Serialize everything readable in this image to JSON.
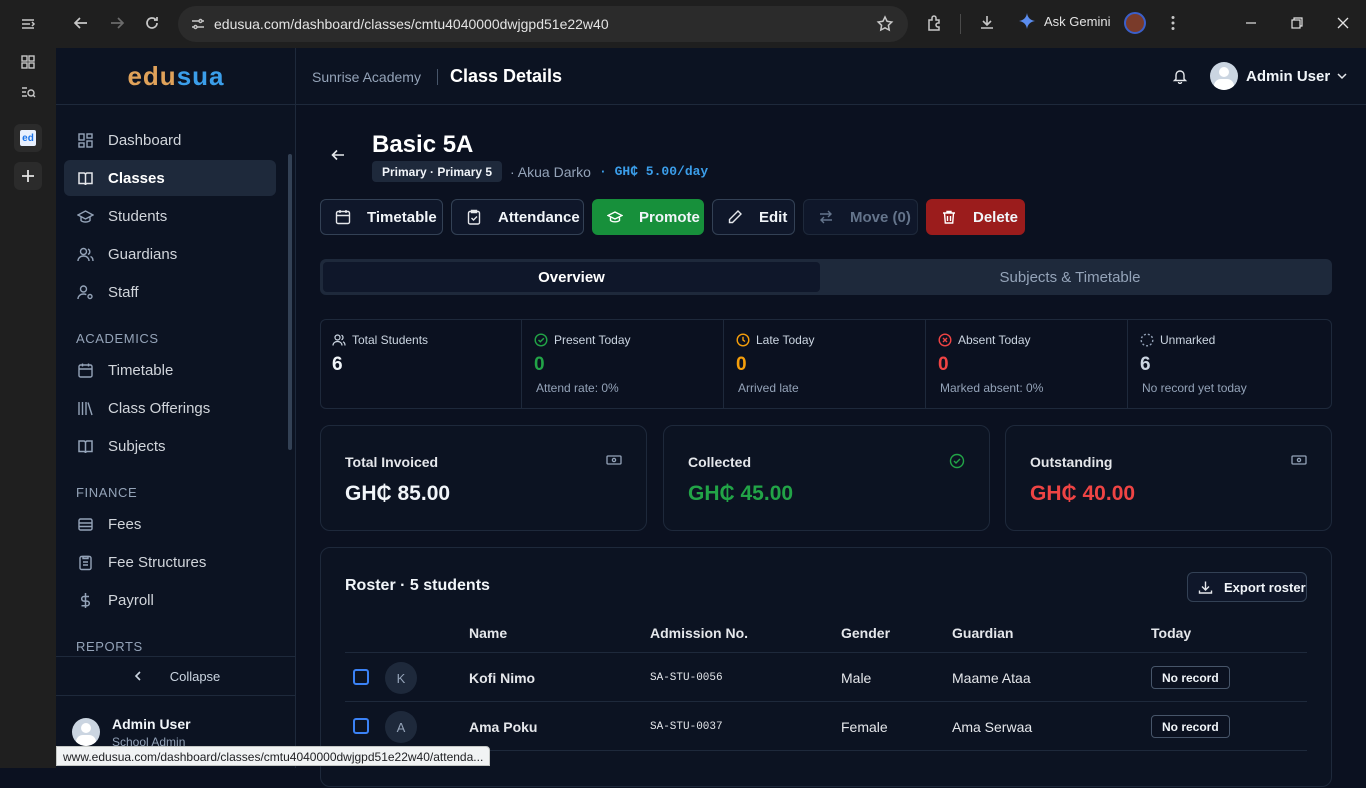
{
  "browser": {
    "url": "edusua.com/dashboard/classes/cmtu4040000dwjgpd51e22w40",
    "gemini_label": "Ask Gemini",
    "status_url": "www.edusua.com/dashboard/classes/cmtu4040000dwjgpd51e22w40/attenda..."
  },
  "sidebar": {
    "brand_part1": "edu",
    "brand_part2": "sua",
    "items": [
      {
        "label": "Dashboard",
        "icon": "dashboard-icon"
      },
      {
        "label": "Classes",
        "icon": "book-icon"
      },
      {
        "label": "Students",
        "icon": "graduation-cap-icon"
      },
      {
        "label": "Guardians",
        "icon": "users-icon"
      },
      {
        "label": "Staff",
        "icon": "user-cog-icon"
      }
    ],
    "academics_label": "ACADEMICS",
    "academics": [
      {
        "label": "Timetable",
        "icon": "calendar-icon"
      },
      {
        "label": "Class Offerings",
        "icon": "library-icon"
      },
      {
        "label": "Subjects",
        "icon": "book-open-icon"
      }
    ],
    "finance_label": "FINANCE",
    "finance": [
      {
        "label": "Fees",
        "icon": "wallet-icon"
      },
      {
        "label": "Fee Structures",
        "icon": "clipboard-icon"
      },
      {
        "label": "Payroll",
        "icon": "dollar-icon"
      }
    ],
    "reports_label": "REPORTS",
    "collapse_label": "Collapse",
    "user_name": "Admin User",
    "user_role": "School Admin"
  },
  "header": {
    "school": "Sunrise Academy",
    "title": "Class Details",
    "user": "Admin User"
  },
  "class_info": {
    "name": "Basic 5A",
    "level_badge": "Primary · Primary 5",
    "teacher": "· Akua Darko",
    "fee": "· GH₵ 5.00/day"
  },
  "actions": {
    "timetable": "Timetable",
    "attendance": "Attendance",
    "promote": "Promote",
    "edit": "Edit",
    "move": "Move (0)",
    "delete": "Delete"
  },
  "tabs": {
    "overview": "Overview",
    "subjects": "Subjects & Timetable"
  },
  "stats": [
    {
      "label": "Total Students",
      "value": "6",
      "sub": ""
    },
    {
      "label": "Present Today",
      "value": "0",
      "sub": "Attend rate: 0%"
    },
    {
      "label": "Late Today",
      "value": "0",
      "sub": "Arrived late"
    },
    {
      "label": "Absent Today",
      "value": "0",
      "sub": "Marked absent: 0%"
    },
    {
      "label": "Unmarked",
      "value": "6",
      "sub": "No record yet today"
    }
  ],
  "finance_cards": {
    "invoiced_label": "Total Invoiced",
    "invoiced_value": "GH₵ 85.00",
    "collected_label": "Collected",
    "collected_value": "GH₵ 45.00",
    "outstanding_label": "Outstanding",
    "outstanding_value": "GH₵ 40.00"
  },
  "roster": {
    "title": "Roster · 5 students",
    "export_label": "Export roster",
    "columns": [
      "Name",
      "Admission No.",
      "Gender",
      "Guardian",
      "Today"
    ],
    "rows": [
      {
        "initial": "K",
        "name": "Kofi Nimo",
        "admission": "SA-STU-0056",
        "gender": "Male",
        "guardian": "Maame Ataa",
        "today": "No record"
      },
      {
        "initial": "A",
        "name": "Ama Poku",
        "admission": "SA-STU-0037",
        "gender": "Female",
        "guardian": "Ama Serwaa",
        "today": "No record"
      }
    ]
  },
  "colors": {
    "brand_orange": "#e0a25a",
    "brand_blue": "#3b9eea",
    "green": "#22a447",
    "red": "#ef4444",
    "amber": "#f59e0b"
  }
}
